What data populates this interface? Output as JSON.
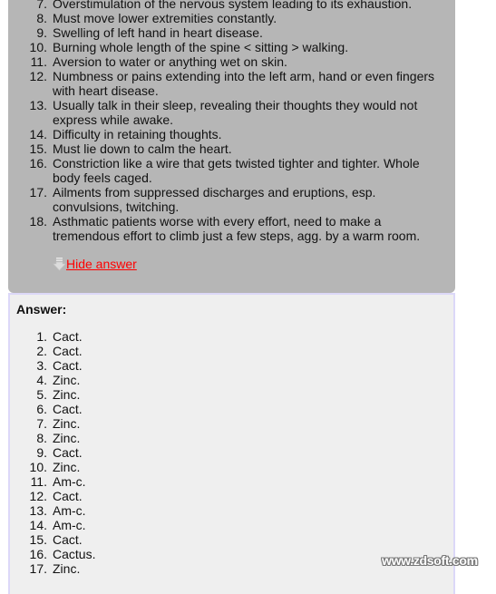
{
  "questions": {
    "items": [
      {
        "n": "7.",
        "text": "Overstimulation of the nervous system leading to its exhaustion."
      },
      {
        "n": "8.",
        "text": "Must move lower extremities constantly."
      },
      {
        "n": "9.",
        "text": "Swelling of left hand in heart disease."
      },
      {
        "n": "10.",
        "text": "Burning whole length of the spine < sitting > walking."
      },
      {
        "n": "11.",
        "text": "Aversion to water or anything wet on skin."
      },
      {
        "n": "12.",
        "text": "Numbness or pains extending into the left arm, hand or even fingers with heart disease."
      },
      {
        "n": "13.",
        "text": "Usually talk in their sleep, revealing their thoughts they would not express while awake."
      },
      {
        "n": "14.",
        "text": "Difficulty in retaining thoughts."
      },
      {
        "n": "15.",
        "text": "Must lie down to calm the heart."
      },
      {
        "n": "16.",
        "text": "Constriction like a wire that gets twisted tighter and tighter. Whole body feels caged."
      },
      {
        "n": "17.",
        "text": "Ailments from suppressed discharges and eruptions, esp. convulsions, twitching."
      },
      {
        "n": "18.",
        "text": "Asthmatic patients worse with every effort, need to make a tremendous effort to climb just a few steps, agg. by a warm room."
      }
    ]
  },
  "toggle": {
    "label": "Hide answer",
    "icon": "down-arrow-icon"
  },
  "answer": {
    "title": "Answer:",
    "items": [
      {
        "n": "1.",
        "text": "Cact."
      },
      {
        "n": "2.",
        "text": "Cact."
      },
      {
        "n": "3.",
        "text": "Cact."
      },
      {
        "n": "4.",
        "text": "Zinc."
      },
      {
        "n": "5.",
        "text": "Zinc."
      },
      {
        "n": "6.",
        "text": "Cact."
      },
      {
        "n": "7.",
        "text": "Zinc."
      },
      {
        "n": "8.",
        "text": "Zinc."
      },
      {
        "n": "9.",
        "text": "Cact."
      },
      {
        "n": "10.",
        "text": "Zinc."
      },
      {
        "n": "11.",
        "text": "Am-c."
      },
      {
        "n": "12.",
        "text": "Cact."
      },
      {
        "n": "13.",
        "text": "Am-c."
      },
      {
        "n": "14.",
        "text": "Am-c."
      },
      {
        "n": "15.",
        "text": "Cact."
      },
      {
        "n": "16.",
        "text": "Cactus."
      },
      {
        "n": "17.",
        "text": "Zinc."
      }
    ]
  },
  "watermark": "www.zdsoft.com",
  "colors": {
    "question_bg": "#b6b6b6",
    "answer_bg": "#efefef",
    "answer_border": "#dcd8f8",
    "link": "#ff0000"
  }
}
